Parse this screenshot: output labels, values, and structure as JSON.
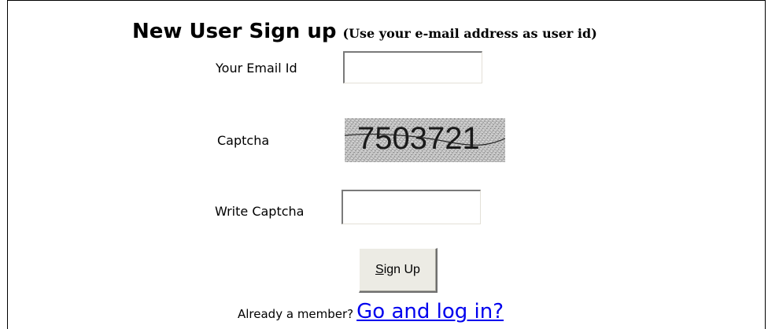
{
  "form": {
    "title": "New User Sign up",
    "subtitle": "(Use your e-mail address as user id)",
    "email_label": "Your Email Id",
    "email_value": "",
    "captcha_label": "Captcha",
    "captcha_code": "7503721",
    "write_captcha_label": "Write Captcha",
    "write_captcha_value": "",
    "signup_mnemonic": "S",
    "signup_rest": "ign Up",
    "member_text": "Already a member?",
    "login_link": "Go and log in?"
  },
  "colors": {
    "link": "#0000ee",
    "button_face": "#ecebe4"
  }
}
